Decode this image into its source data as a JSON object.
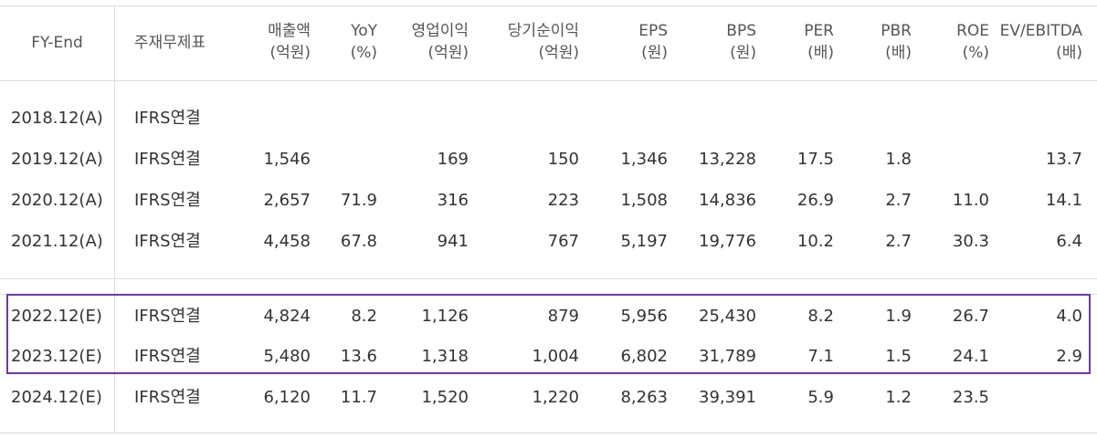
{
  "table": {
    "headers": [
      {
        "label": "FY-End",
        "unit": ""
      },
      {
        "label": "주재무제표",
        "unit": ""
      },
      {
        "label": "매출액",
        "unit": "(억원)"
      },
      {
        "label": "YoY",
        "unit": "(%)"
      },
      {
        "label": "영업이익",
        "unit": "(억원)"
      },
      {
        "label": "당기순이익",
        "unit": "(억원)"
      },
      {
        "label": "EPS",
        "unit": "(원)"
      },
      {
        "label": "BPS",
        "unit": "(원)"
      },
      {
        "label": "PER",
        "unit": "(배)"
      },
      {
        "label": "PBR",
        "unit": "(배)"
      },
      {
        "label": "ROE",
        "unit": "(%)"
      },
      {
        "label": "EV/EBITDA",
        "unit": "(배)"
      }
    ],
    "rows": [
      [
        "2018.12(A)",
        "IFRS연결",
        "",
        "",
        "",
        "",
        "",
        "",
        "",
        "",
        "",
        ""
      ],
      [
        "2019.12(A)",
        "IFRS연결",
        "1,546",
        "",
        "169",
        "150",
        "1,346",
        "13,228",
        "17.5",
        "1.8",
        "",
        "13.7"
      ],
      [
        "2020.12(A)",
        "IFRS연결",
        "2,657",
        "71.9",
        "316",
        "223",
        "1,508",
        "14,836",
        "26.9",
        "2.7",
        "11.0",
        "14.1"
      ],
      [
        "2021.12(A)",
        "IFRS연결",
        "4,458",
        "67.8",
        "941",
        "767",
        "5,197",
        "19,776",
        "10.2",
        "2.7",
        "30.3",
        "6.4"
      ],
      [
        "2022.12(E)",
        "IFRS연결",
        "4,824",
        "8.2",
        "1,126",
        "879",
        "5,956",
        "25,430",
        "8.2",
        "1.9",
        "26.7",
        "4.0"
      ],
      [
        "2023.12(E)",
        "IFRS연결",
        "5,480",
        "13.6",
        "1,318",
        "1,004",
        "6,802",
        "31,789",
        "7.1",
        "1.5",
        "24.1",
        "2.9"
      ],
      [
        "2024.12(E)",
        "IFRS연결",
        "6,120",
        "11.7",
        "1,520",
        "1,220",
        "8,263",
        "39,391",
        "5.9",
        "1.2",
        "23.5",
        ""
      ]
    ],
    "highlight_color": "#6b3a9c"
  }
}
